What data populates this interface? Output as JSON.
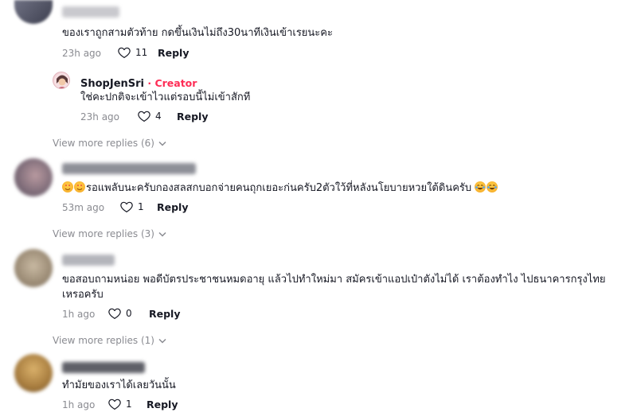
{
  "comments": [
    {
      "text": "ของเราถูกสามตัวท้าย กดขึ้นเงินไม่ถึง30นาทีเงินเข้าเรยนะคะ",
      "time": "23h ago",
      "likes": "11",
      "reply_label": "Reply",
      "reply": {
        "username": "ShopJenSri",
        "separator": " · ",
        "badge": "Creator",
        "text": "ใช่คะปกติจะเข้าไวแต่รอบนี้ไม่เข้าสักที",
        "time": "23h ago",
        "likes": "4",
        "reply_label": "Reply"
      },
      "view_more": "View more replies (6)"
    },
    {
      "text": "รอแพลับนะครับกองสลสกบอกจ่ายคนถุกเยอะก่นครับ2ตัวใว้ที่หลังนโยบายหวยใต้ดินครับ",
      "time": "53m ago",
      "likes": "1",
      "reply_label": "Reply",
      "view_more": "View more replies (3)"
    },
    {
      "text_line1": "ขอสอบถามหน่อย พอดีบัตรประชาชนหมดอายุ แล้วไปทำใหม่มา สมัครเข้าแอปเป๋าตังไม่ได้ เราต้องทำไง ไปธนาคารกรุงไทย",
      "text_line2": "เหรอครับ",
      "time": "1h ago",
      "likes": "0",
      "reply_label": "Reply",
      "view_more": "View more replies (1)"
    },
    {
      "text": "ทำมัยของเราได้เลยวันนั้น",
      "time": "1h ago",
      "likes": "1",
      "reply_label": "Reply"
    }
  ],
  "icons": {
    "heart": "heart-outline-icon",
    "chevron": "chevron-down-icon",
    "emoji_love": "smiling-face-with-heart-eyes-icon",
    "emoji_laugh": "face-with-tears-of-joy-icon"
  },
  "colors": {
    "creator_badge": "#fe2c55",
    "muted_text": "#8a8b91"
  }
}
